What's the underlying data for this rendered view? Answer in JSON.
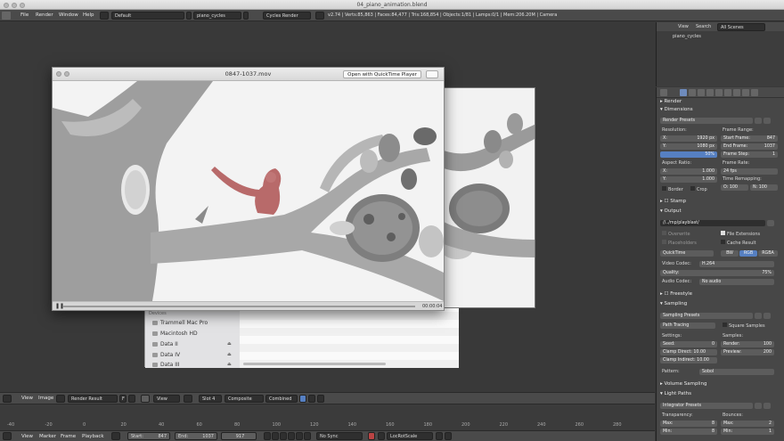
{
  "mac_title": "04_piano_animation.blend",
  "header": {
    "menus": [
      "File",
      "Render",
      "Window",
      "Help"
    ],
    "screen_layout": "Default",
    "scene": "piano_cycles",
    "render_engine": "Cycles Render",
    "stats": "v2.74 | Verts:85,863 | Faces:84,477 | Tris:168,854 | Objects:1/81 | Lamps:0/1 | Mem:206.20M | Camera"
  },
  "outliner": {
    "view": "View",
    "search": "Search",
    "scenes": "All Scenes",
    "item": "piano_cycles"
  },
  "properties": {
    "render_label": "Render",
    "dimensions": "Dimensions",
    "render_presets": "Render Presets",
    "resolution": "Resolution:",
    "res_x": "X:",
    "res_x_val": "1920 px",
    "res_y": "Y:",
    "res_y_val": "1080 px",
    "res_pct": "50%",
    "frame_range": "Frame Range:",
    "start_frame": "Start Frame:",
    "start_frame_val": "847",
    "end_frame": "End Frame:",
    "end_frame_val": "1037",
    "frame_step": "Frame Step:",
    "frame_step_val": "1",
    "aspect_ratio": "Aspect Ratio:",
    "asp_x": "X:",
    "asp_x_val": "1.000",
    "asp_y": "Y:",
    "asp_y_val": "1.000",
    "frame_rate": "Frame Rate:",
    "fps": "24 fps",
    "time_remapping": "Time Remapping:",
    "remap_old": "O: 100",
    "remap_new": "N: 100",
    "border": "Border",
    "crop": "Crop",
    "stamp": "Stamp",
    "output": "Output",
    "output_path": "//../mp/playblast/",
    "overwrite": "Overwrite",
    "file_extensions": "File Extensions",
    "placeholders": "Placeholders",
    "cache_result": "Cache Result",
    "format": "QuickTime",
    "bw": "BW",
    "rgb": "RGB",
    "rgba": "RGBA",
    "video_codec": "Video Codec:",
    "video_codec_val": "H.264",
    "quality": "Quality:",
    "quality_val": "75%",
    "audio_codec": "Audio Codec:",
    "audio_codec_val": "No audio",
    "freestyle": "Freestyle",
    "sampling": "Sampling",
    "sampling_presets": "Sampling Presets",
    "path_tracing": "Path Tracing",
    "square_samples": "Square Samples",
    "settings": "Settings:",
    "samples": "Samples:",
    "seed": "Seed:",
    "seed_val": "0",
    "render_samples": "Render:",
    "render_samples_val": "100",
    "clamp_direct": "Clamp Direct: 10.00",
    "preview_samples": "Preview:",
    "preview_samples_val": "200",
    "clamp_indirect": "Clamp Indirect: 10.00",
    "pattern": "Pattern:",
    "pattern_val": "Sobol",
    "volume_sampling": "Volume Sampling",
    "light_paths": "Light Paths",
    "integrator_presets": "Integrator Presets",
    "transparency": "Transparency:",
    "bounces": "Bounces:",
    "t_max": "Max:",
    "t_max_val": "8",
    "t_min": "Min:",
    "t_min_val": "8",
    "b_max": "Max:",
    "b_max_val": "2",
    "b_min": "Min:",
    "b_min_val": "1"
  },
  "image_editor": {
    "view": "View",
    "image": "Image",
    "image_name": "Render Result",
    "f": "F",
    "view2": "View",
    "slot": "Slot 4",
    "layer": "Composite",
    "pass": "Combined"
  },
  "timeline": {
    "ticks": [
      "-40",
      "-20",
      "0",
      "20",
      "40",
      "60",
      "80",
      "100",
      "120",
      "140",
      "160",
      "180",
      "200",
      "220",
      "240",
      "260",
      "280"
    ],
    "view": "View",
    "marker": "Marker",
    "frame": "Frame",
    "playback": "Playback",
    "start_label": "Start:",
    "start_val": "847",
    "end_label": "End:",
    "end_val": "1037",
    "current": "917",
    "sync": "No Sync",
    "keying": "LocRotScale"
  },
  "finder": {
    "devices": "Devices",
    "items": [
      "Trammell Mac Pro",
      "Macintosh HD",
      "Data II",
      "Data IV",
      "Data III"
    ]
  },
  "quicktime": {
    "title": "0847-1037.mov",
    "open_button": "Open with QuickTime Player",
    "time": "00:00:04",
    "progress": 0.0
  }
}
